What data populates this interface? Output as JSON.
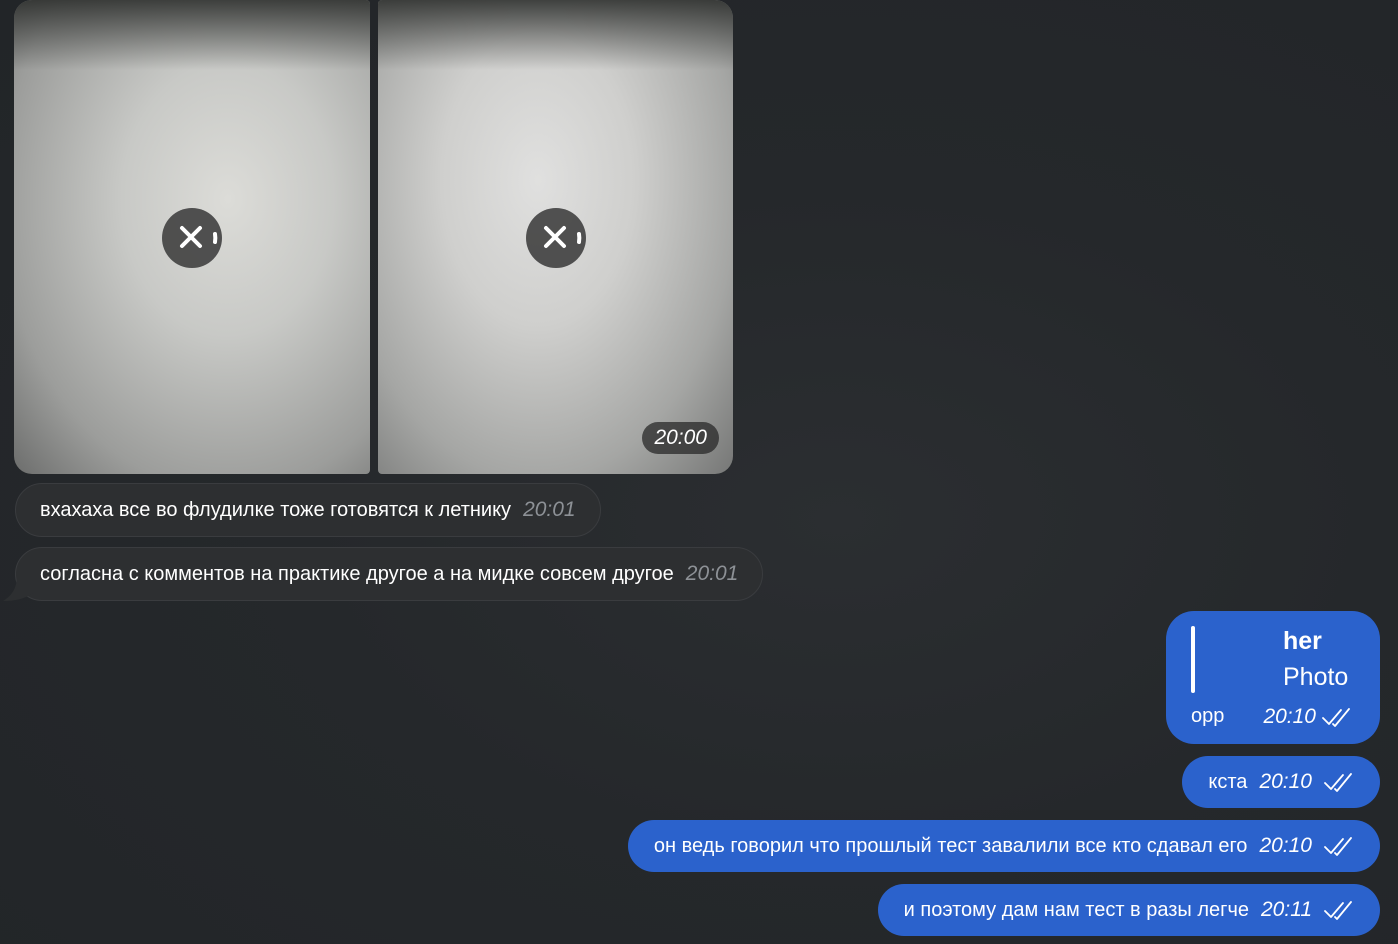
{
  "album": {
    "photos": [
      {
        "label": "photo-1",
        "status_icon": "close-icon"
      },
      {
        "label": "photo-2",
        "status_icon": "close-icon"
      }
    ],
    "time": "20:00"
  },
  "incoming": [
    {
      "text": "вхахаха все во флудилке тоже готовятся к летнику",
      "time": "20:01"
    },
    {
      "text": "согласна с комментов на практике другое а на мидке совсем другое",
      "time": "20:01"
    }
  ],
  "reply_message": {
    "quote_title": "her",
    "quote_subtitle": "Photo",
    "text": "орр",
    "time": "20:10",
    "status_icon": "double-check-icon"
  },
  "outgoing": [
    {
      "text": "кста",
      "time": "20:10",
      "status_icon": "double-check-icon"
    },
    {
      "text": "он ведь говорил что прошлый тест завалили все кто сдавал его",
      "time": "20:10",
      "status_icon": "double-check-icon"
    },
    {
      "text": "и поэтому дам нам тест в разы легче",
      "time": "20:11",
      "status_icon": "double-check-icon"
    }
  ],
  "colors": {
    "background": "#25282b",
    "incoming_bubble": "#2d2f31",
    "outgoing_bubble": "#2b62cc",
    "incoming_time": "#8d9196"
  }
}
